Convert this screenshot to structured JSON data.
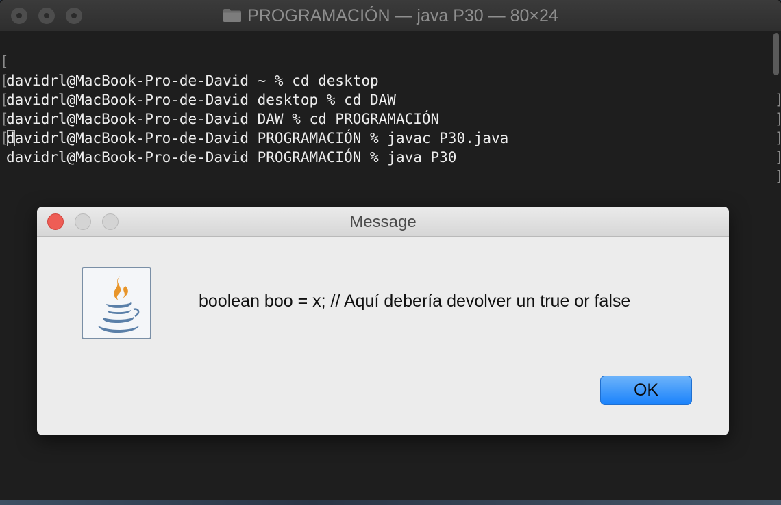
{
  "terminal": {
    "title": "PROGRAMACIÓN — java P30 — 80×24",
    "title_icon": "folder-icon",
    "lines": [
      "davidrl@MacBook-Pro-de-David ~ % cd desktop",
      "davidrl@MacBook-Pro-de-David desktop % cd DAW",
      "davidrl@MacBook-Pro-de-David DAW % cd PROGRAMACIÓN",
      "davidrl@MacBook-Pro-de-David PROGRAMACIÓN % javac P30.java",
      "davidrl@MacBook-Pro-de-David PROGRAMACIÓN % java P30"
    ],
    "bracket_left": "[",
    "bracket_right": "]"
  },
  "dialog": {
    "title": "Message",
    "icon": "java-icon",
    "message": "boolean boo = x; // Aquí debería devolver un true or false",
    "ok_label": "OK"
  },
  "colors": {
    "terminal_bg": "#1e1e1e",
    "terminal_text": "#ededed",
    "dialog_bg": "#ececec",
    "close_button": "#ee5d55",
    "ok_button": "#1a82fb"
  }
}
